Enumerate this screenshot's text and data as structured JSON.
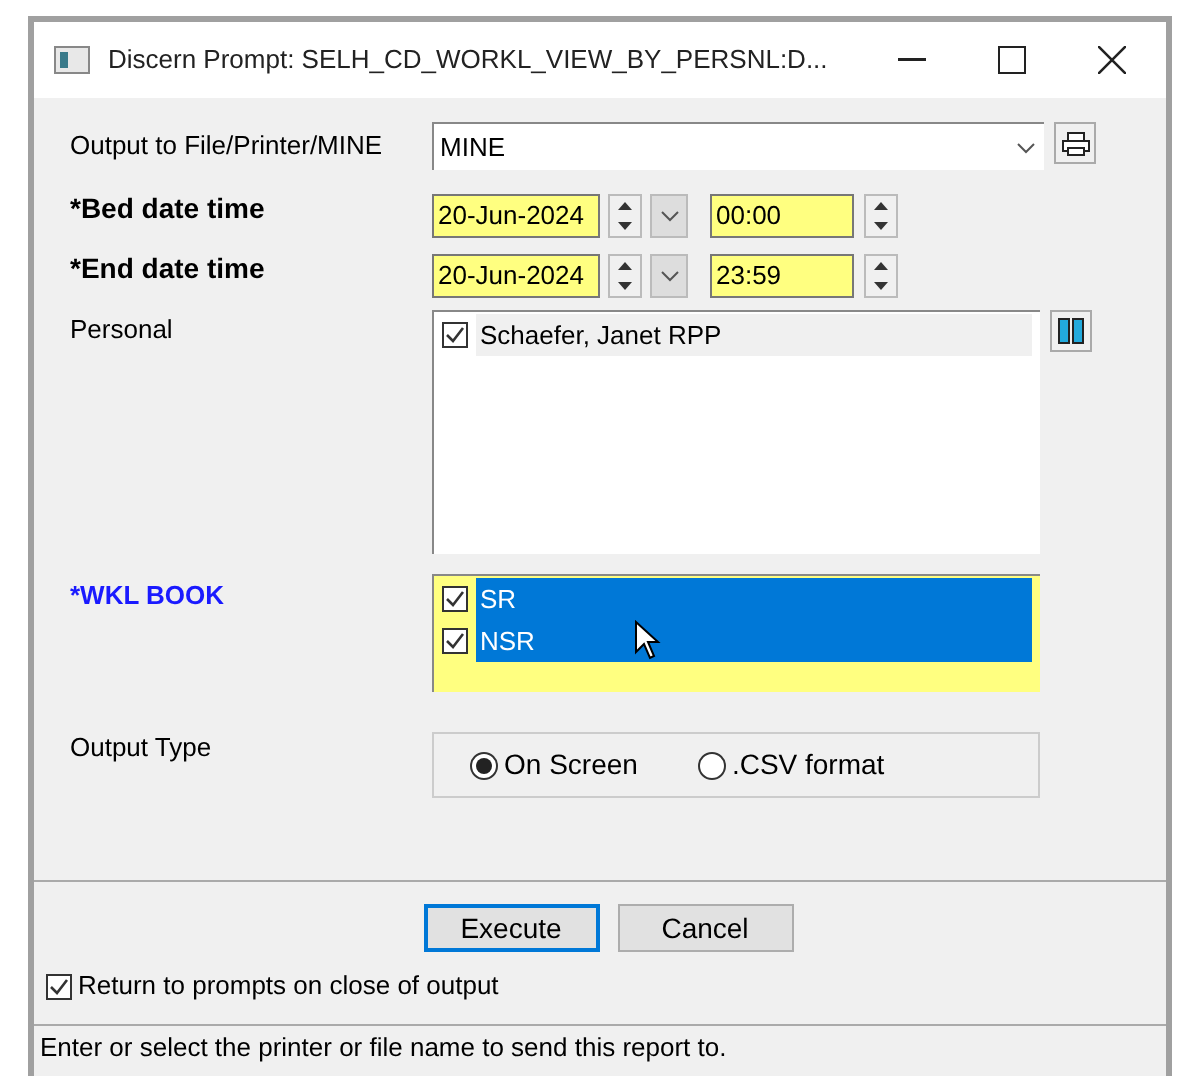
{
  "window": {
    "title": "Discern Prompt: SELH_CD_WORKL_VIEW_BY_PERSNL:D..."
  },
  "output": {
    "label": "Output to File/Printer/MINE",
    "value": "MINE"
  },
  "date_rows": [
    {
      "label": "*Bed date time",
      "date": "20-Jun-2024",
      "time": "00:00"
    },
    {
      "label": "*End date time",
      "date": "20-Jun-2024",
      "time": "23:59"
    }
  ],
  "personal": {
    "label": "Personal",
    "items": [
      {
        "label": "Schaefer, Janet RPP",
        "checked": true,
        "selected": false
      }
    ]
  },
  "wkl_book": {
    "label": "*WKL BOOK",
    "items": [
      {
        "label": "SR",
        "checked": true,
        "selected": true
      },
      {
        "label": "NSR",
        "checked": true,
        "selected": true
      }
    ]
  },
  "output_type": {
    "label": "Output Type",
    "options": [
      {
        "label": "On Screen",
        "selected": true
      },
      {
        "label": ".CSV format",
        "selected": false
      }
    ]
  },
  "buttons": [
    {
      "label": "Execute",
      "default": true
    },
    {
      "label": "Cancel",
      "default": false
    }
  ],
  "return_option": {
    "label": "Return to prompts on close of output",
    "checked": true
  },
  "status_bar": "Enter or select the printer or file name to send this report to."
}
